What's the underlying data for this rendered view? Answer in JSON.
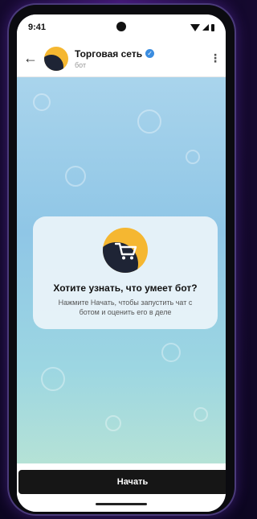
{
  "status_bar": {
    "time": "9:41"
  },
  "header": {
    "back_icon": "arrow-left-icon",
    "title": "Торговая сеть",
    "subtitle": "бот",
    "verified_icon": "verified-check-icon",
    "menu_icon": "more-vertical-icon"
  },
  "card": {
    "icon": "shopping-cart-icon",
    "title": "Хотите узнать, что умеет бот?",
    "text": "Нажмите Начать, чтобы запустить чат с ботом и оценить его в деле"
  },
  "bottom": {
    "start_label": "Начать"
  },
  "colors": {
    "accent": "#f5b731",
    "dark": "#1e2435",
    "button": "#161616",
    "verified": "#3b8de0"
  }
}
